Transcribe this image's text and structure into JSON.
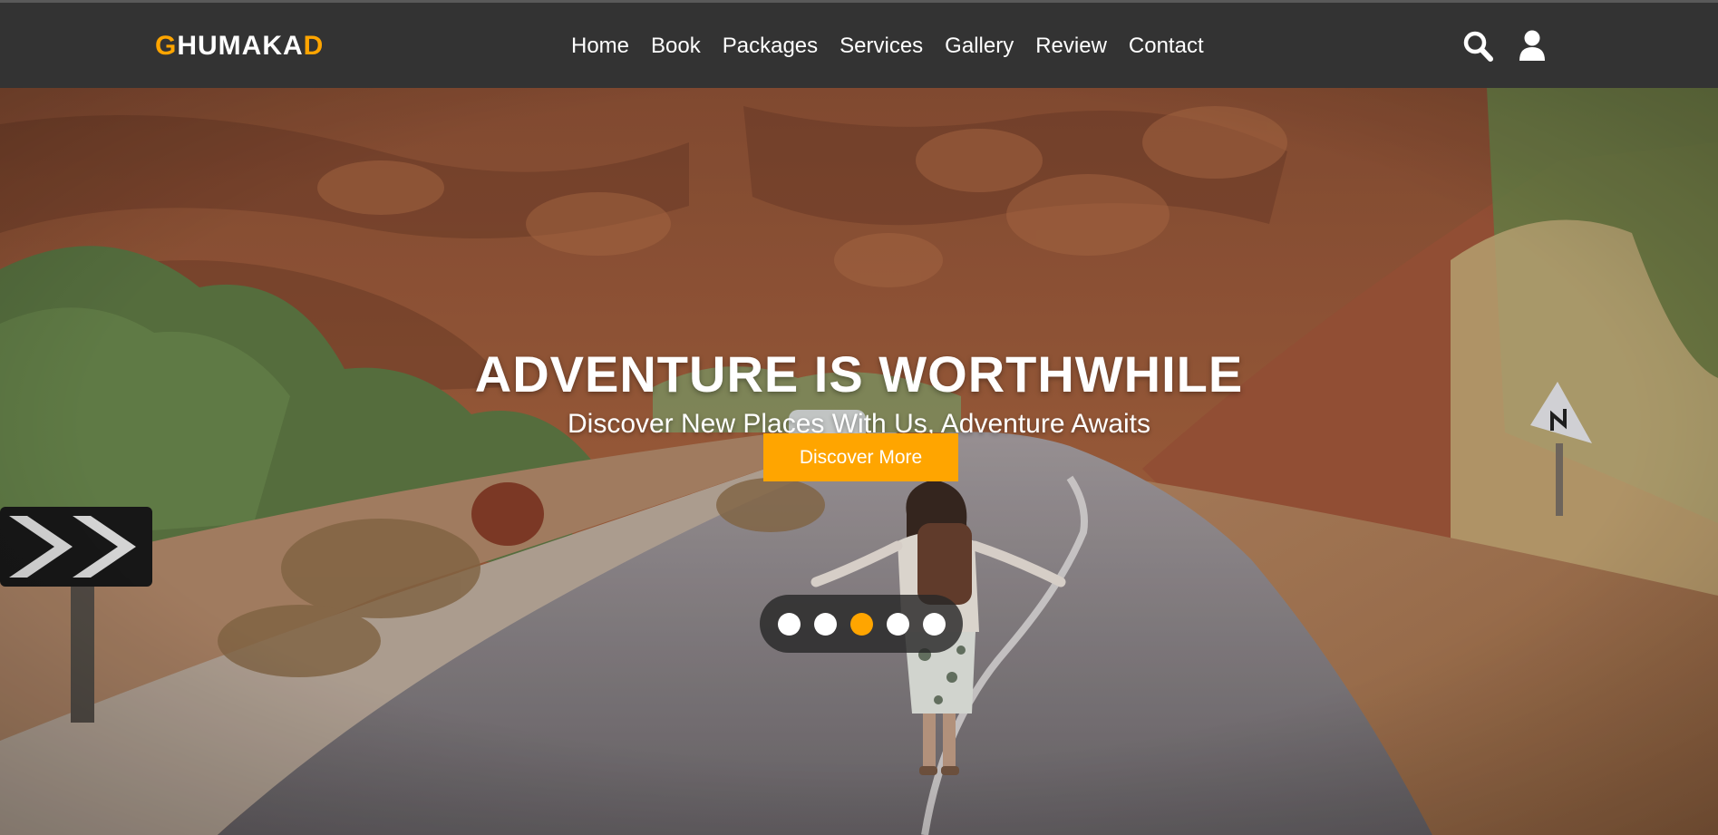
{
  "brand": {
    "first_letter": "G",
    "middle": "HUMAKA",
    "last_letter": "D",
    "accent_color": "#ffa500"
  },
  "nav": {
    "links": [
      "Home",
      "Book",
      "Packages",
      "Services",
      "Gallery",
      "Review",
      "Contact"
    ],
    "icons": [
      "search-icon",
      "user-icon"
    ]
  },
  "hero": {
    "title": "ADVENTURE IS WORTHWHILE",
    "subtitle": "Discover New Places With Us, Adventure Awaits",
    "button_label": "Discover More",
    "slider": {
      "count": 5,
      "active_index": 2
    }
  },
  "colors": {
    "navbar_bg": "#333333",
    "accent": "#ffa500",
    "text": "#ffffff"
  }
}
